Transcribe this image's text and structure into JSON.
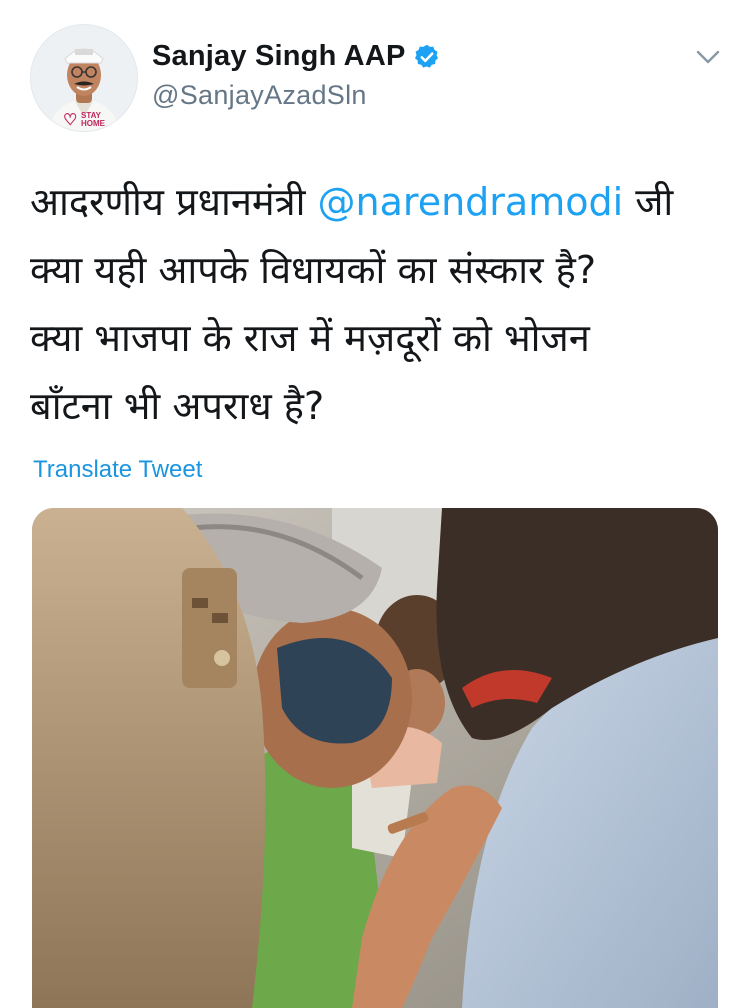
{
  "tweet": {
    "display_name": "Sanjay Singh AAP",
    "handle": "@SanjayAzadSln",
    "avatar_badge": "STAY HOME",
    "text_lines": [
      [
        "आदरणीय प्रधानमंत्री ",
        "@narendramodi",
        " जी"
      ],
      [
        "क्या यही आपके विधायकों का संस्कार है?"
      ],
      [
        "क्या भाजपा के राज में मज़दूरों को भोजन"
      ],
      [
        "बाँटना भी अपराध है?"
      ]
    ],
    "translate_label": "Translate Tweet",
    "icons": {
      "verified": "verified-badge-icon",
      "menu": "chevron-down-icon"
    },
    "colors": {
      "link": "#1da1f2",
      "verified": "#1da1f2",
      "secondary_text": "#657786"
    }
  }
}
